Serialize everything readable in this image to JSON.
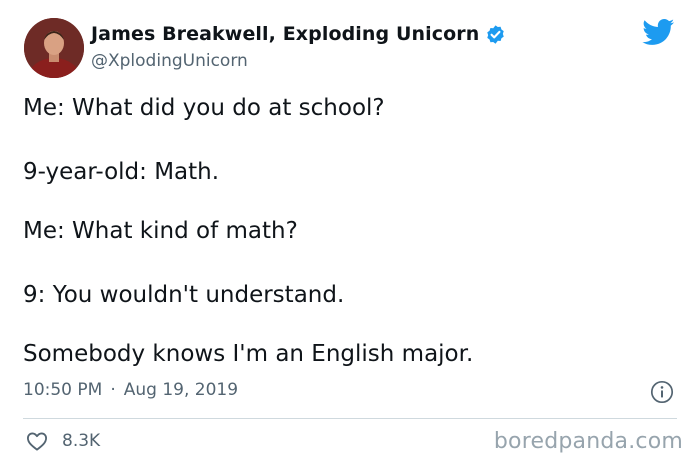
{
  "author": {
    "display_name": "James Breakwell, Exploding Unicorn",
    "handle": "@XplodingUnicorn",
    "verified_icon": "verified-badge-icon",
    "avatar_bg": "#7d2a24"
  },
  "tweet": {
    "lines": [
      "Me: What did you do at school?",
      "9-year-old: Math.",
      "Me: What kind of math?",
      "9: You wouldn't understand.",
      "Somebody knows I'm an English major."
    ],
    "time": "10:50 PM",
    "separator": "·",
    "date": "Aug 19, 2019"
  },
  "stats": {
    "likes": "8.3K"
  },
  "watermark": "boredpanda.com",
  "colors": {
    "twitter_blue": "#1d9bf0",
    "secondary_text": "#536471",
    "primary_text": "#0f1419"
  }
}
